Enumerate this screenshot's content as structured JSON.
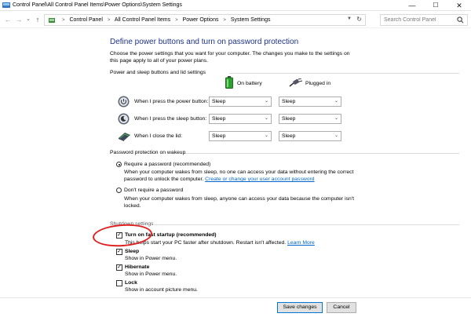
{
  "window": {
    "title": "Control Panel\\All Control Panel Items\\Power Options\\System Settings",
    "minimize": "—",
    "maximize": "☐",
    "close": "✕"
  },
  "nav": {
    "back": "←",
    "forward": "→",
    "history": "⌄",
    "up": "↑",
    "breadcrumbs": [
      "Control Panel",
      "All Control Panel Items",
      "Power Options",
      "System Settings"
    ],
    "search_placeholder": "Search Control Panel"
  },
  "page": {
    "heading": "Define power buttons and turn on password protection",
    "intro": "Choose the power settings that you want for your computer. The changes you make to the settings on this page apply to all of your power plans."
  },
  "buttons_section": {
    "header": "Power and sleep buttons and lid settings",
    "col_battery": "On battery",
    "col_plugged": "Plugged in",
    "rows": [
      {
        "label": "When I press the power button:",
        "battery": "Sleep",
        "plugged": "Sleep"
      },
      {
        "label": "When I press the sleep button:",
        "battery": "Sleep",
        "plugged": "Sleep"
      },
      {
        "label": "When I close the lid:",
        "battery": "Sleep",
        "plugged": "Sleep"
      }
    ]
  },
  "password_section": {
    "header": "Password protection on wakeup",
    "options": [
      {
        "label": "Require a password (recommended)",
        "desc": "When your computer wakes from sleep, no one can access your data without entering the correct password to unlock the computer.",
        "link": "Create or change your user account password",
        "selected": true
      },
      {
        "label": "Don't require a password",
        "desc": "When your computer wakes from sleep, anyone can access your data because the computer isn't locked.",
        "selected": false
      }
    ]
  },
  "shutdown_section": {
    "header": "Shutdown settings",
    "items": [
      {
        "label": "Turn on fast startup (recommended)",
        "desc": "This helps start your PC faster after shutdown. Restart isn't affected.",
        "link": "Learn More",
        "checked": true
      },
      {
        "label": "Sleep",
        "desc": "Show in Power menu.",
        "checked": true
      },
      {
        "label": "Hibernate",
        "desc": "Show in Power menu.",
        "checked": true
      },
      {
        "label": "Lock",
        "desc": "Show in account picture menu.",
        "checked": false
      }
    ]
  },
  "footer": {
    "save": "Save changes",
    "cancel": "Cancel"
  },
  "colors": {
    "heading": "#1e3287",
    "link": "#0066cc",
    "annotation": "#e02020"
  }
}
